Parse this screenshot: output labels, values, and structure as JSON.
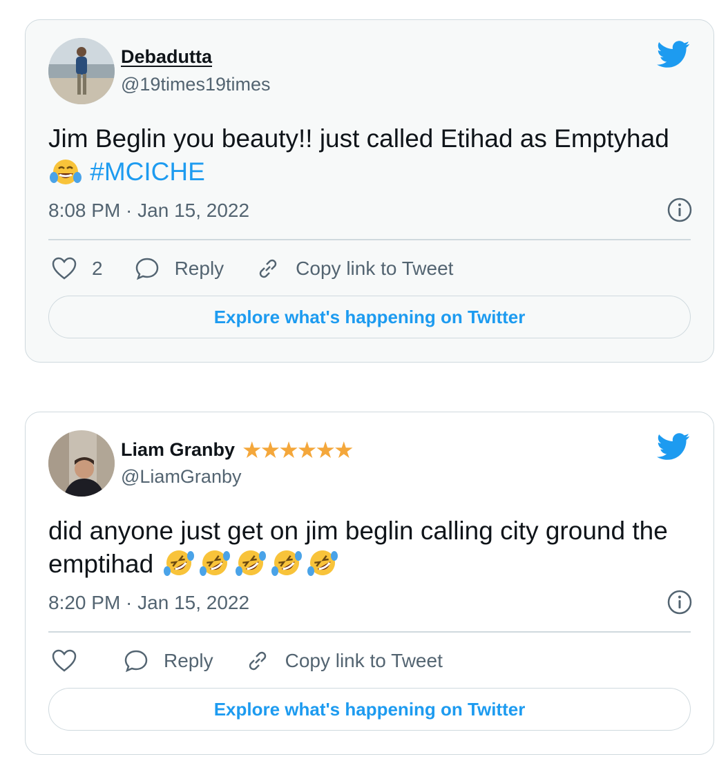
{
  "tweets": [
    {
      "name": "Debadutta",
      "name_badges": "",
      "handle": "@19times19times",
      "text": "Jim Beglin you beauty!! just called Etihad as Emptyhad",
      "hashtag": "#MCICHE",
      "emoji": "face-with-tears-of-joy",
      "emoji_count": 1,
      "timestamp": "8:08 PM · Jan 15, 2022",
      "likes": "2",
      "reply_label": "Reply",
      "copy_label": "Copy link to Tweet",
      "explore_label": "Explore what's happening on Twitter"
    },
    {
      "name": "Liam Granby",
      "name_badges": "★★★★★★",
      "handle": "@LiamGranby",
      "text": "did anyone just get on jim beglin calling city ground the emptihad",
      "hashtag": "",
      "emoji": "rolling-on-floor-laughing",
      "emoji_count": 5,
      "timestamp": "8:20 PM · Jan 15, 2022",
      "likes": "",
      "reply_label": "Reply",
      "copy_label": "Copy link to Tweet",
      "explore_label": "Explore what's happening on Twitter"
    }
  ],
  "colors": {
    "accent": "#1d9bf0",
    "muted_text": "#536471",
    "border": "#cfd9de",
    "star": "#f4a73b"
  }
}
